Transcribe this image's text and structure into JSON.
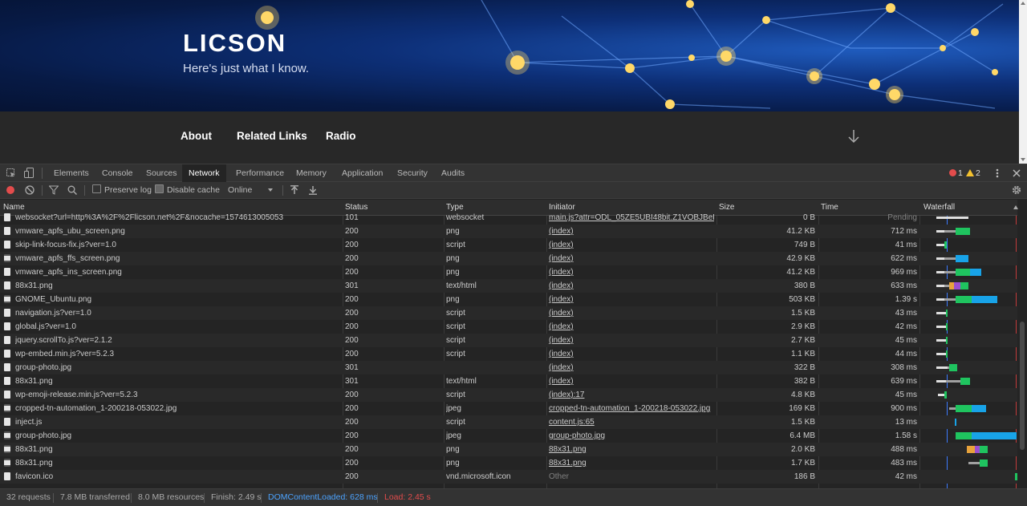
{
  "site": {
    "title": "LICSON",
    "tagline": "Here's just what I know.",
    "nav": [
      "About",
      "Related Links",
      "Radio"
    ],
    "scroll_icon": "arrow-down-icon"
  },
  "devtools": {
    "tabs": [
      "Elements",
      "Console",
      "Sources",
      "Network",
      "Performance",
      "Memory",
      "Application",
      "Security",
      "Audits"
    ],
    "active_tab": "Network",
    "errors": "1",
    "warnings": "2",
    "toolbar": {
      "preserve_log": "Preserve log",
      "disable_cache": "Disable cache",
      "throttling": "Online"
    },
    "columns": [
      "Name",
      "Status",
      "Type",
      "Initiator",
      "Size",
      "Time",
      "Waterfall"
    ],
    "rows": [
      {
        "name": "websocket?url=http%3A%2F%2Flicson.net%2F&nocache=1574613005053",
        "status": "101",
        "type": "websocket",
        "initiator": "main.js?attr=ODL_05ZE5UBI48bit.Z1VOBJBeL...",
        "size": "0 B",
        "time": "Pending",
        "icon": "file-icon"
      },
      {
        "name": "vmware_apfs_ubu_screen.png",
        "status": "200",
        "type": "png",
        "initiator": "(index)",
        "size": "41.2 KB",
        "time": "712 ms",
        "icon": "file-icon"
      },
      {
        "name": "skip-link-focus-fix.js?ver=1.0",
        "status": "200",
        "type": "script",
        "initiator": "(index)",
        "size": "749 B",
        "time": "41 ms",
        "icon": "file-icon"
      },
      {
        "name": "vmware_apfs_ffs_screen.png",
        "status": "200",
        "type": "png",
        "initiator": "(index)",
        "size": "42.9 KB",
        "time": "622 ms",
        "icon": "image-icon"
      },
      {
        "name": "vmware_apfs_ins_screen.png",
        "status": "200",
        "type": "png",
        "initiator": "(index)",
        "size": "41.2 KB",
        "time": "969 ms",
        "icon": "file-icon"
      },
      {
        "name": "88x31.png",
        "status": "301",
        "type": "text/html",
        "initiator": "(index)",
        "size": "380 B",
        "time": "633 ms",
        "icon": "file-icon"
      },
      {
        "name": "GNOME_Ubuntu.png",
        "status": "200",
        "type": "png",
        "initiator": "(index)",
        "size": "503 KB",
        "time": "1.39 s",
        "icon": "image-icon"
      },
      {
        "name": "navigation.js?ver=1.0",
        "status": "200",
        "type": "script",
        "initiator": "(index)",
        "size": "1.5 KB",
        "time": "43 ms",
        "icon": "file-icon"
      },
      {
        "name": "global.js?ver=1.0",
        "status": "200",
        "type": "script",
        "initiator": "(index)",
        "size": "2.9 KB",
        "time": "42 ms",
        "icon": "file-icon"
      },
      {
        "name": "jquery.scrollTo.js?ver=2.1.2",
        "status": "200",
        "type": "script",
        "initiator": "(index)",
        "size": "2.7 KB",
        "time": "45 ms",
        "icon": "file-icon"
      },
      {
        "name": "wp-embed.min.js?ver=5.2.3",
        "status": "200",
        "type": "script",
        "initiator": "(index)",
        "size": "1.1 KB",
        "time": "44 ms",
        "icon": "file-icon"
      },
      {
        "name": "group-photo.jpg",
        "status": "301",
        "type": "",
        "initiator": "(index)",
        "size": "322 B",
        "time": "308 ms",
        "icon": "file-icon"
      },
      {
        "name": "88x31.png",
        "status": "301",
        "type": "text/html",
        "initiator": "(index)",
        "size": "382 B",
        "time": "639 ms",
        "icon": "file-icon"
      },
      {
        "name": "wp-emoji-release.min.js?ver=5.2.3",
        "status": "200",
        "type": "script",
        "initiator": "(index):17",
        "size": "4.8 KB",
        "time": "45 ms",
        "icon": "file-icon"
      },
      {
        "name": "cropped-tn-automation_1-200218-053022.jpg",
        "status": "200",
        "type": "jpeg",
        "initiator": "cropped-tn-automation_1-200218-053022.jpg",
        "size": "169 KB",
        "time": "900 ms",
        "icon": "image-icon"
      },
      {
        "name": "inject.js",
        "status": "200",
        "type": "script",
        "initiator": "content.js:65",
        "size": "1.5 KB",
        "time": "13 ms",
        "icon": "file-icon"
      },
      {
        "name": "group-photo.jpg",
        "status": "200",
        "type": "jpeg",
        "initiator": "group-photo.jpg",
        "size": "6.4 MB",
        "time": "1.58 s",
        "icon": "image-icon"
      },
      {
        "name": "88x31.png",
        "status": "200",
        "type": "png",
        "initiator": "88x31.png",
        "size": "2.0 KB",
        "time": "488 ms",
        "icon": "image-icon"
      },
      {
        "name": "88x31.png",
        "status": "200",
        "type": "png",
        "initiator": "88x31.png",
        "size": "1.7 KB",
        "time": "483 ms",
        "icon": "image-icon"
      },
      {
        "name": "favicon.ico",
        "status": "200",
        "type": "vnd.microsoft.icon",
        "initiator": "Other",
        "size": "186 B",
        "time": "42 ms",
        "icon": "file-icon"
      }
    ],
    "summary": {
      "requests": "32 requests",
      "transferred": "7.8 MB transferred",
      "resources": "8.0 MB resources",
      "finish": "Finish: 2.49 s",
      "dom_loaded": "DOMContentLoaded: 628 ms",
      "load": "Load: 2.45 s"
    }
  },
  "colors": {
    "accent": "#1a73e8",
    "dom_loaded": "#4ca3ff",
    "load": "#e34c4c",
    "wf_wait": "#1fc45f",
    "wf_download": "#18a3e8",
    "wf_queue": "#e0e0e0",
    "wf_stalled": "#a0a0a0"
  }
}
